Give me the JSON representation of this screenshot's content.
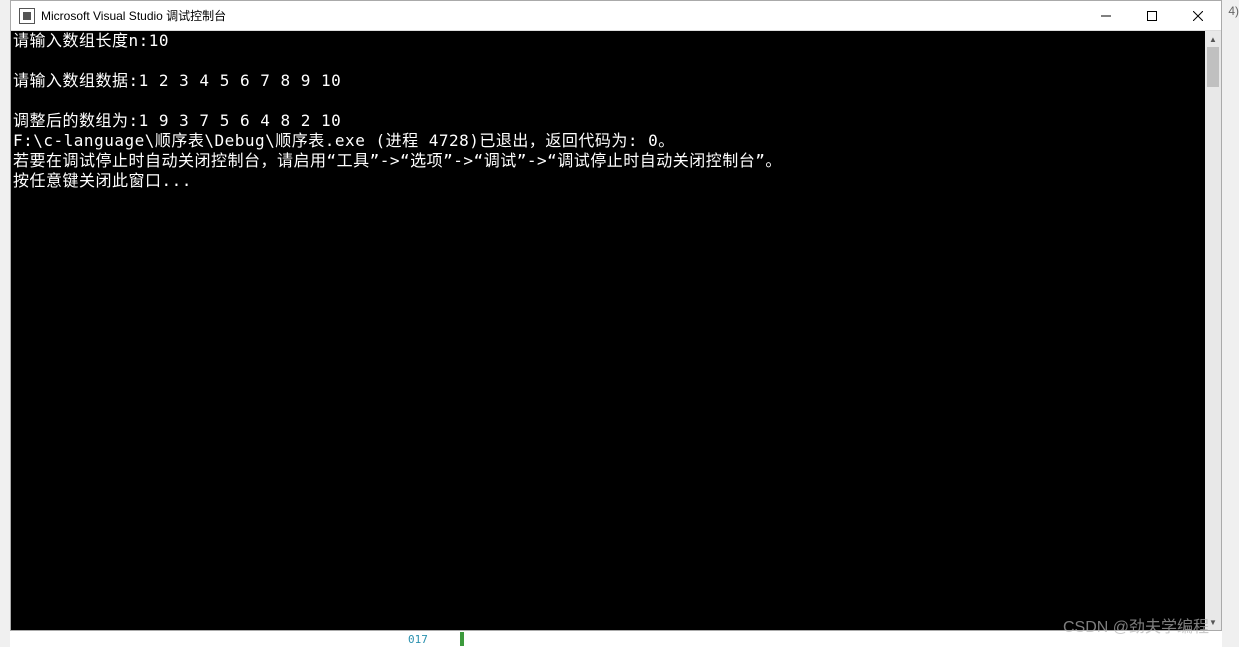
{
  "window": {
    "title": "Microsoft Visual Studio 调试控制台"
  },
  "rightEdge": "4)",
  "console": {
    "lines": "请输入数组长度n:10\n\n请输入数组数据:1 2 3 4 5 6 7 8 9 10\n\n调整后的数组为:1 9 3 7 5 6 4 8 2 10\nF:\\c-language\\顺序表\\Debug\\顺序表.exe (进程 4728)已退出，返回代码为: 0。\n若要在调试停止时自动关闭控制台，请启用“工具”->“选项”->“调试”->“调试停止时自动关闭控制台”。\n按任意键关闭此窗口..."
  },
  "watermark": "CSDN @劲夫学编程",
  "bottomNumber": "017"
}
